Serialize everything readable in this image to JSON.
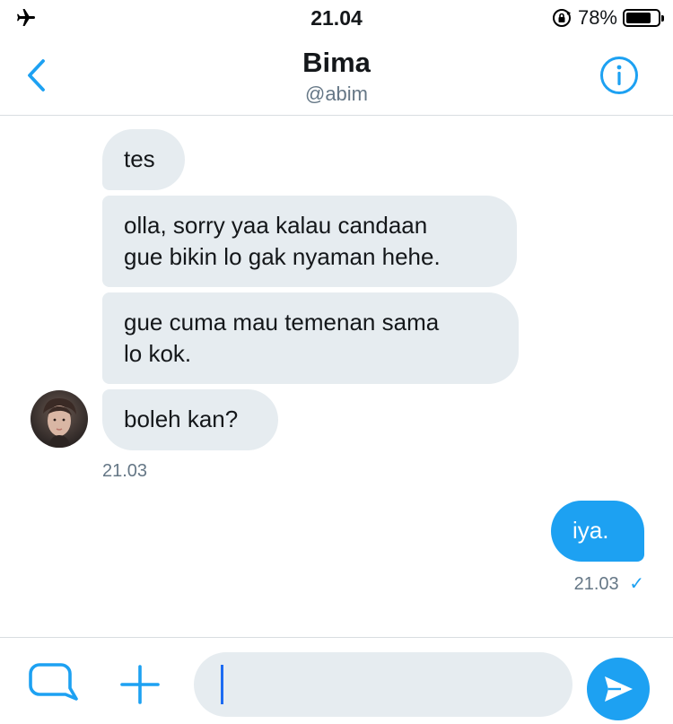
{
  "status_bar": {
    "time": "21.04",
    "battery_text": "78%",
    "battery_level": 0.78,
    "icons": [
      "airplane-mode-icon",
      "orientation-lock-icon",
      "battery-icon"
    ]
  },
  "header": {
    "name": "Bima",
    "handle": "@abim",
    "icons": [
      "back-chevron-icon",
      "info-icon"
    ]
  },
  "messages": [
    {
      "direction": "incoming",
      "lines": [
        "tes"
      ]
    },
    {
      "direction": "incoming",
      "lines": [
        "olla, sorry yaa kalau candaan",
        "gue bikin lo gak nyaman hehe."
      ]
    },
    {
      "direction": "incoming",
      "lines": [
        "gue cuma mau temenan sama",
        "lo kok."
      ]
    },
    {
      "direction": "incoming",
      "lines": [
        "boleh kan?"
      ],
      "timestamp": "21.03"
    },
    {
      "direction": "outgoing",
      "lines": [
        "iya."
      ],
      "timestamp": "21.03",
      "status_icon": "read-check-icon",
      "status_glyph": "✓"
    }
  ],
  "composer": {
    "value": "",
    "icons": [
      "media-icon",
      "plus-icon",
      "send-icon"
    ]
  },
  "colors": {
    "accent": "#1da1f2",
    "incoming_bubble": "#e6ecf0",
    "secondary_text": "#657786",
    "divider": "#d9dde1"
  }
}
